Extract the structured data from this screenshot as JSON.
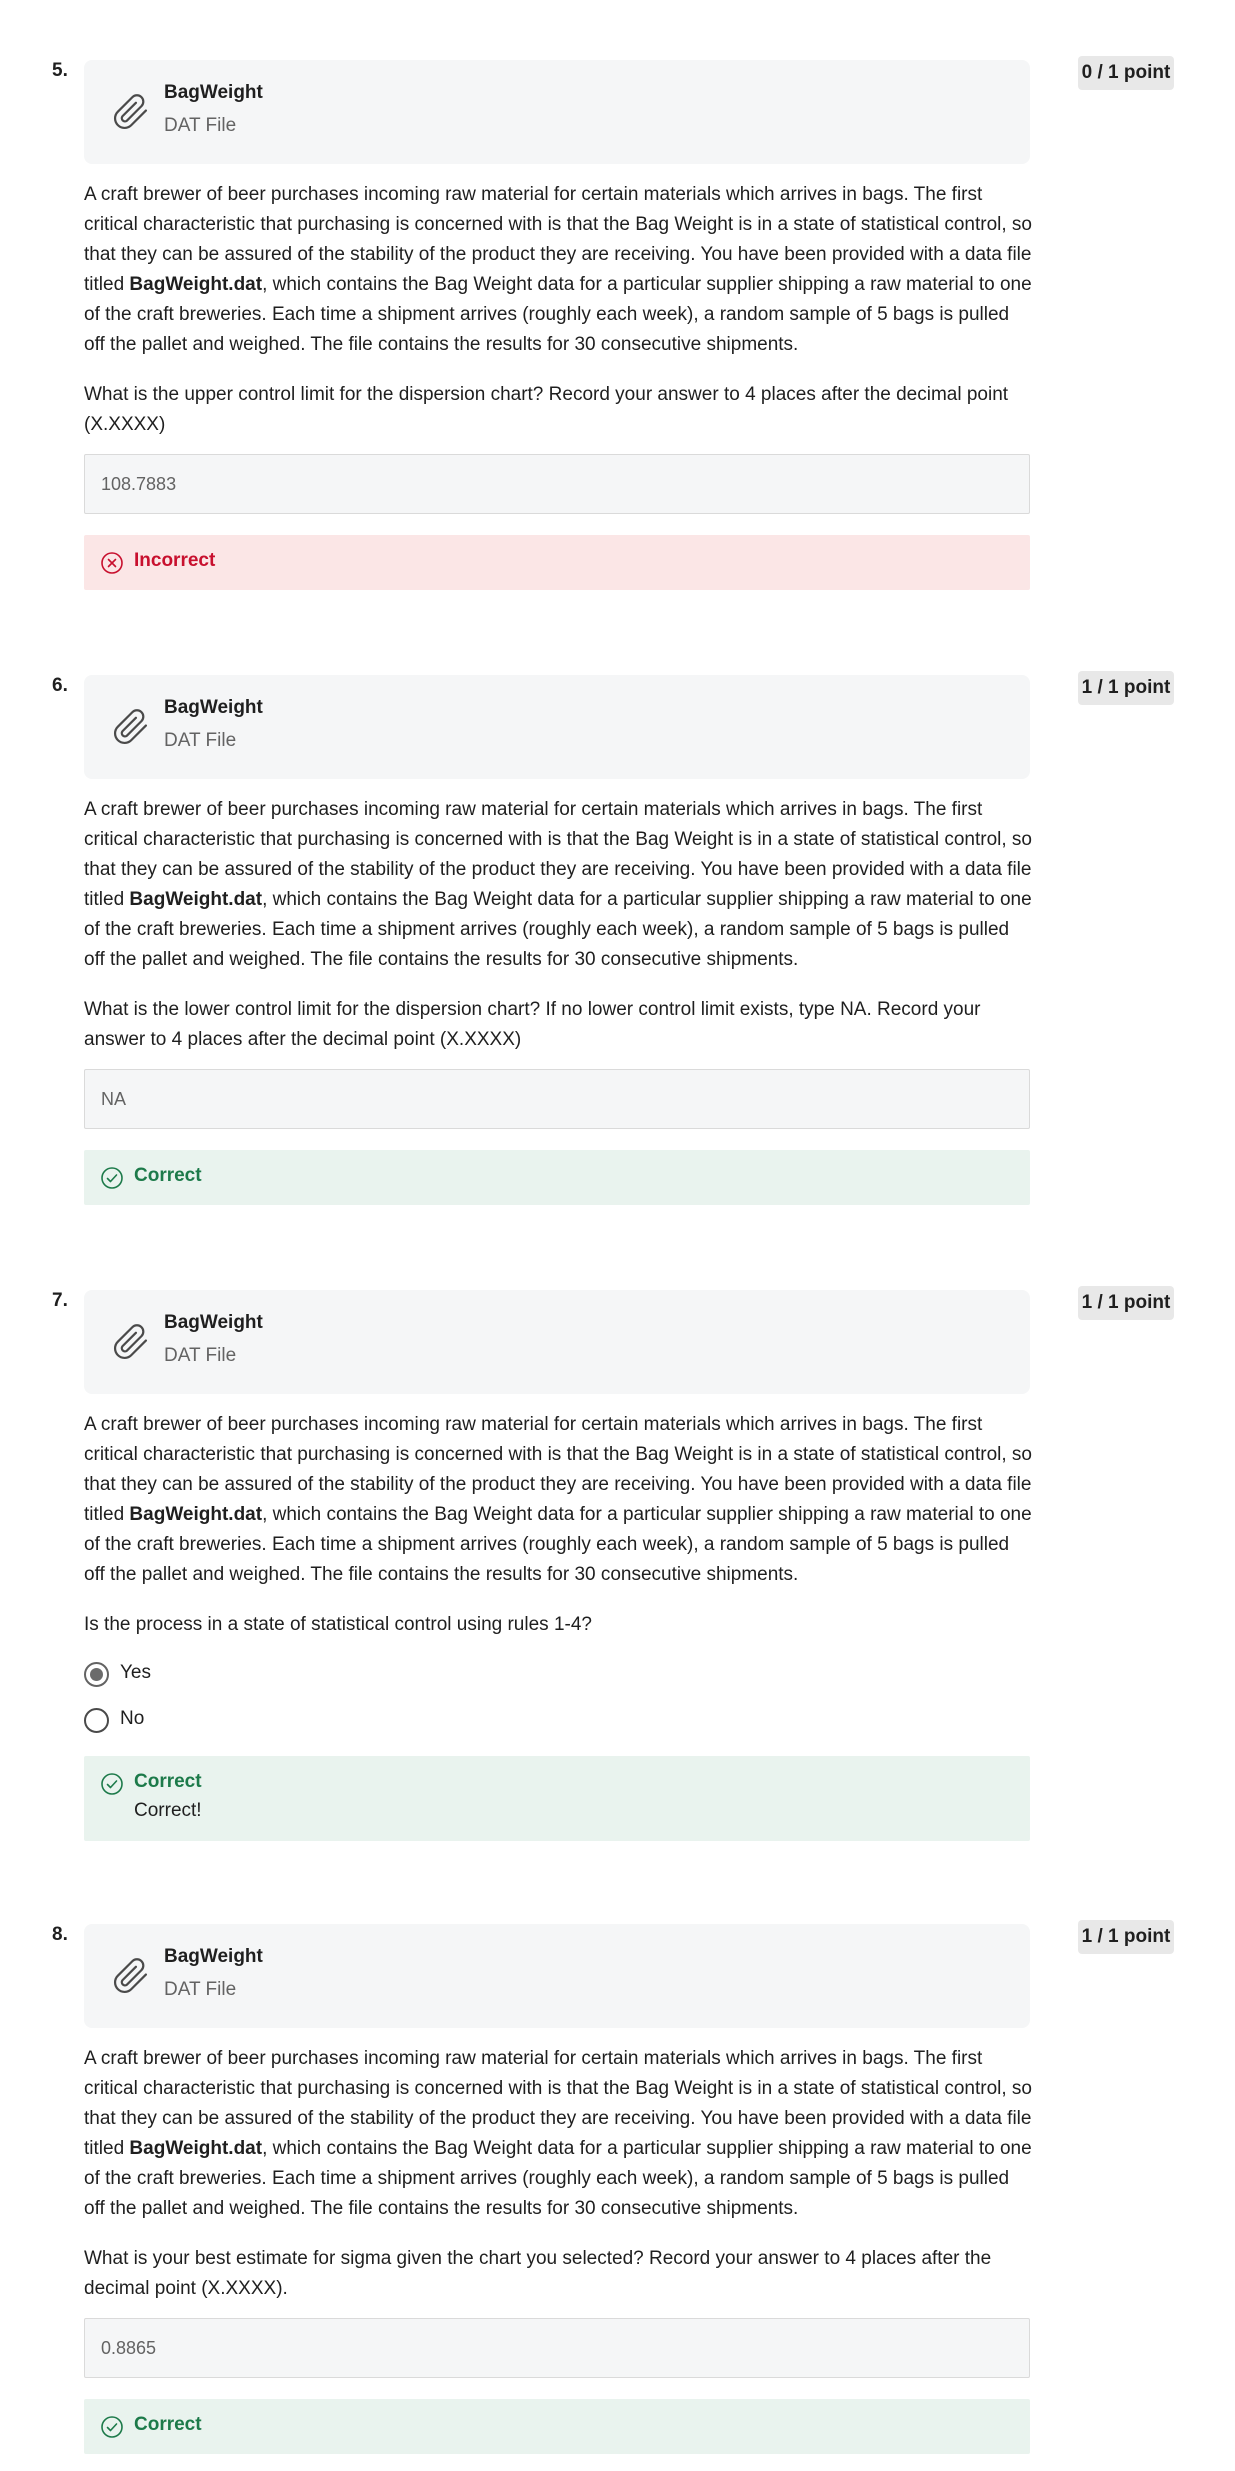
{
  "attachment": {
    "title": "BagWeight",
    "subtitle": "DAT File",
    "icon": "paperclip-icon"
  },
  "description": {
    "part1": "A craft brewer of beer purchases incoming raw material for certain materials which arrives in bags. The first critical characteristic that purchasing is concerned with is that the Bag Weight is in a state of statistical control, so that they can be assured of the stability of the product they are receiving. You have been provided with a data file titled ",
    "filename": "BagWeight.dat",
    "part2": ", which contains the Bag Weight data for a particular supplier shipping a raw material to one of the craft breweries. Each time a shipment arrives (roughly each week), a random sample of 5 bags is pulled off the pallet and weighed. The file contains the results for 30 consecutive shipments."
  },
  "colors": {
    "incorrect_bg": "#fbe6e6",
    "incorrect_text": "#c8102e",
    "correct_bg": "#e9f3ee",
    "correct_text": "#1d7a4a"
  },
  "questions": [
    {
      "number": "5.",
      "points": "0 / 1 point",
      "prompt": "What is the upper control limit for the dispersion chart? Record your answer to 4 places after the decimal point (X.XXXX)",
      "answer": "108.7883",
      "feedback": {
        "status": "Incorrect",
        "icon": "x-circle-icon"
      }
    },
    {
      "number": "6.",
      "points": "1 / 1 point",
      "prompt": "What is the lower control limit for the dispersion chart? If no lower control limit exists, type NA. Record your answer to 4 places after the decimal point (X.XXXX)",
      "answer": "NA",
      "feedback": {
        "status": "Correct",
        "icon": "check-circle-icon"
      }
    },
    {
      "number": "7.",
      "points": "1 / 1 point",
      "prompt": "Is the process in a state of statistical control using rules 1-4?",
      "options": [
        {
          "label": "Yes",
          "selected": true
        },
        {
          "label": "No",
          "selected": false
        }
      ],
      "feedback": {
        "status": "Correct",
        "icon": "check-circle-icon",
        "message": "Correct!"
      }
    },
    {
      "number": "8.",
      "points": "1 / 1 point",
      "prompt": "What is your best estimate for sigma given the chart you selected? Record your answer to 4 places after the decimal point (X.XXXX).",
      "answer": "0.8865",
      "feedback": {
        "status": "Correct",
        "icon": "check-circle-icon"
      }
    }
  ]
}
